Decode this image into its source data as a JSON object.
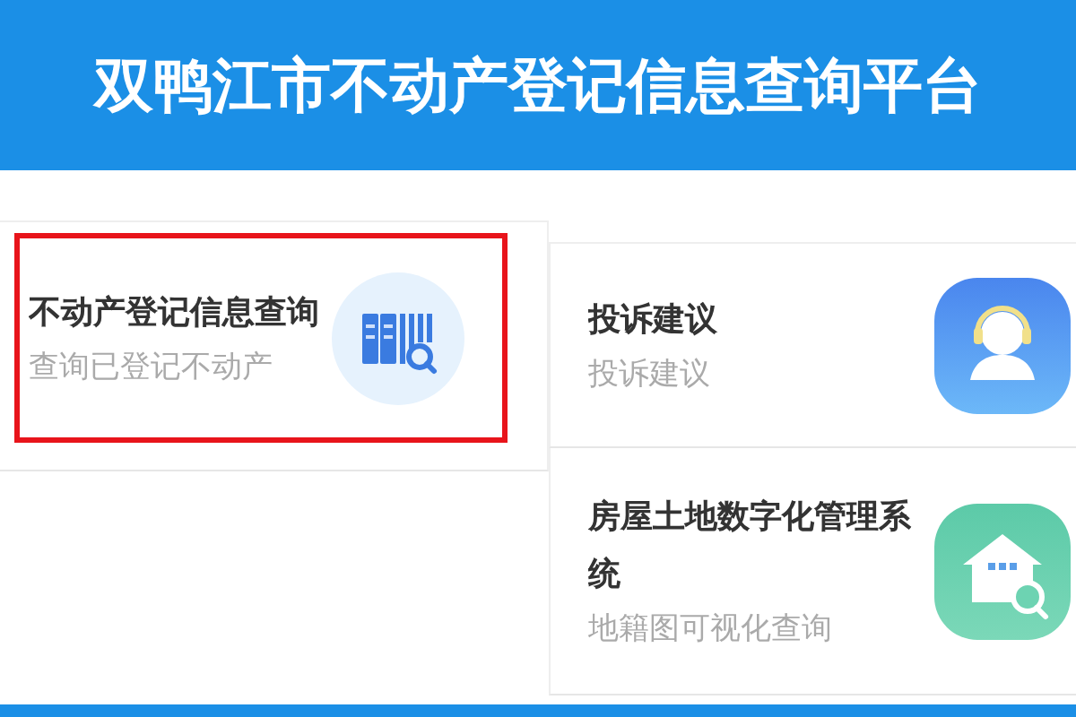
{
  "header": {
    "title": "双鸭江市不动产登记信息查询平台"
  },
  "services": [
    {
      "title": "不动产登记信息查询",
      "subtitle": "查询已登记不动产",
      "highlighted": true
    },
    {
      "title": "投诉建议",
      "subtitle": "投诉建议",
      "highlighted": false
    },
    {
      "title": "房屋土地数字化管理系统",
      "subtitle": "地籍图可视化查询",
      "highlighted": false
    }
  ]
}
